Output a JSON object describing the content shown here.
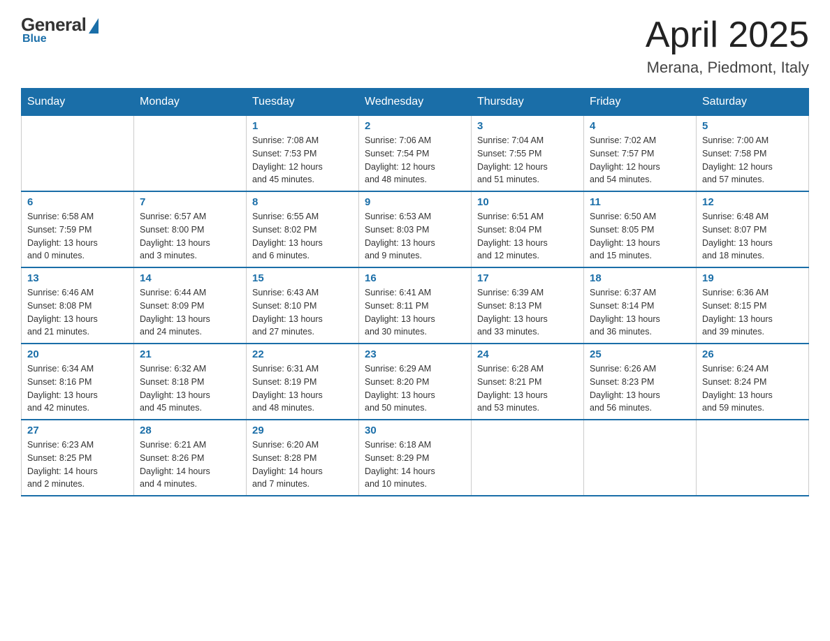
{
  "header": {
    "logo_general": "General",
    "logo_blue": "Blue",
    "title": "April 2025",
    "subtitle": "Merana, Piedmont, Italy"
  },
  "days_of_week": [
    "Sunday",
    "Monday",
    "Tuesday",
    "Wednesday",
    "Thursday",
    "Friday",
    "Saturday"
  ],
  "weeks": [
    [
      {
        "day": "",
        "info": ""
      },
      {
        "day": "",
        "info": ""
      },
      {
        "day": "1",
        "info": "Sunrise: 7:08 AM\nSunset: 7:53 PM\nDaylight: 12 hours\nand 45 minutes."
      },
      {
        "day": "2",
        "info": "Sunrise: 7:06 AM\nSunset: 7:54 PM\nDaylight: 12 hours\nand 48 minutes."
      },
      {
        "day": "3",
        "info": "Sunrise: 7:04 AM\nSunset: 7:55 PM\nDaylight: 12 hours\nand 51 minutes."
      },
      {
        "day": "4",
        "info": "Sunrise: 7:02 AM\nSunset: 7:57 PM\nDaylight: 12 hours\nand 54 minutes."
      },
      {
        "day": "5",
        "info": "Sunrise: 7:00 AM\nSunset: 7:58 PM\nDaylight: 12 hours\nand 57 minutes."
      }
    ],
    [
      {
        "day": "6",
        "info": "Sunrise: 6:58 AM\nSunset: 7:59 PM\nDaylight: 13 hours\nand 0 minutes."
      },
      {
        "day": "7",
        "info": "Sunrise: 6:57 AM\nSunset: 8:00 PM\nDaylight: 13 hours\nand 3 minutes."
      },
      {
        "day": "8",
        "info": "Sunrise: 6:55 AM\nSunset: 8:02 PM\nDaylight: 13 hours\nand 6 minutes."
      },
      {
        "day": "9",
        "info": "Sunrise: 6:53 AM\nSunset: 8:03 PM\nDaylight: 13 hours\nand 9 minutes."
      },
      {
        "day": "10",
        "info": "Sunrise: 6:51 AM\nSunset: 8:04 PM\nDaylight: 13 hours\nand 12 minutes."
      },
      {
        "day": "11",
        "info": "Sunrise: 6:50 AM\nSunset: 8:05 PM\nDaylight: 13 hours\nand 15 minutes."
      },
      {
        "day": "12",
        "info": "Sunrise: 6:48 AM\nSunset: 8:07 PM\nDaylight: 13 hours\nand 18 minutes."
      }
    ],
    [
      {
        "day": "13",
        "info": "Sunrise: 6:46 AM\nSunset: 8:08 PM\nDaylight: 13 hours\nand 21 minutes."
      },
      {
        "day": "14",
        "info": "Sunrise: 6:44 AM\nSunset: 8:09 PM\nDaylight: 13 hours\nand 24 minutes."
      },
      {
        "day": "15",
        "info": "Sunrise: 6:43 AM\nSunset: 8:10 PM\nDaylight: 13 hours\nand 27 minutes."
      },
      {
        "day": "16",
        "info": "Sunrise: 6:41 AM\nSunset: 8:11 PM\nDaylight: 13 hours\nand 30 minutes."
      },
      {
        "day": "17",
        "info": "Sunrise: 6:39 AM\nSunset: 8:13 PM\nDaylight: 13 hours\nand 33 minutes."
      },
      {
        "day": "18",
        "info": "Sunrise: 6:37 AM\nSunset: 8:14 PM\nDaylight: 13 hours\nand 36 minutes."
      },
      {
        "day": "19",
        "info": "Sunrise: 6:36 AM\nSunset: 8:15 PM\nDaylight: 13 hours\nand 39 minutes."
      }
    ],
    [
      {
        "day": "20",
        "info": "Sunrise: 6:34 AM\nSunset: 8:16 PM\nDaylight: 13 hours\nand 42 minutes."
      },
      {
        "day": "21",
        "info": "Sunrise: 6:32 AM\nSunset: 8:18 PM\nDaylight: 13 hours\nand 45 minutes."
      },
      {
        "day": "22",
        "info": "Sunrise: 6:31 AM\nSunset: 8:19 PM\nDaylight: 13 hours\nand 48 minutes."
      },
      {
        "day": "23",
        "info": "Sunrise: 6:29 AM\nSunset: 8:20 PM\nDaylight: 13 hours\nand 50 minutes."
      },
      {
        "day": "24",
        "info": "Sunrise: 6:28 AM\nSunset: 8:21 PM\nDaylight: 13 hours\nand 53 minutes."
      },
      {
        "day": "25",
        "info": "Sunrise: 6:26 AM\nSunset: 8:23 PM\nDaylight: 13 hours\nand 56 minutes."
      },
      {
        "day": "26",
        "info": "Sunrise: 6:24 AM\nSunset: 8:24 PM\nDaylight: 13 hours\nand 59 minutes."
      }
    ],
    [
      {
        "day": "27",
        "info": "Sunrise: 6:23 AM\nSunset: 8:25 PM\nDaylight: 14 hours\nand 2 minutes."
      },
      {
        "day": "28",
        "info": "Sunrise: 6:21 AM\nSunset: 8:26 PM\nDaylight: 14 hours\nand 4 minutes."
      },
      {
        "day": "29",
        "info": "Sunrise: 6:20 AM\nSunset: 8:28 PM\nDaylight: 14 hours\nand 7 minutes."
      },
      {
        "day": "30",
        "info": "Sunrise: 6:18 AM\nSunset: 8:29 PM\nDaylight: 14 hours\nand 10 minutes."
      },
      {
        "day": "",
        "info": ""
      },
      {
        "day": "",
        "info": ""
      },
      {
        "day": "",
        "info": ""
      }
    ]
  ]
}
